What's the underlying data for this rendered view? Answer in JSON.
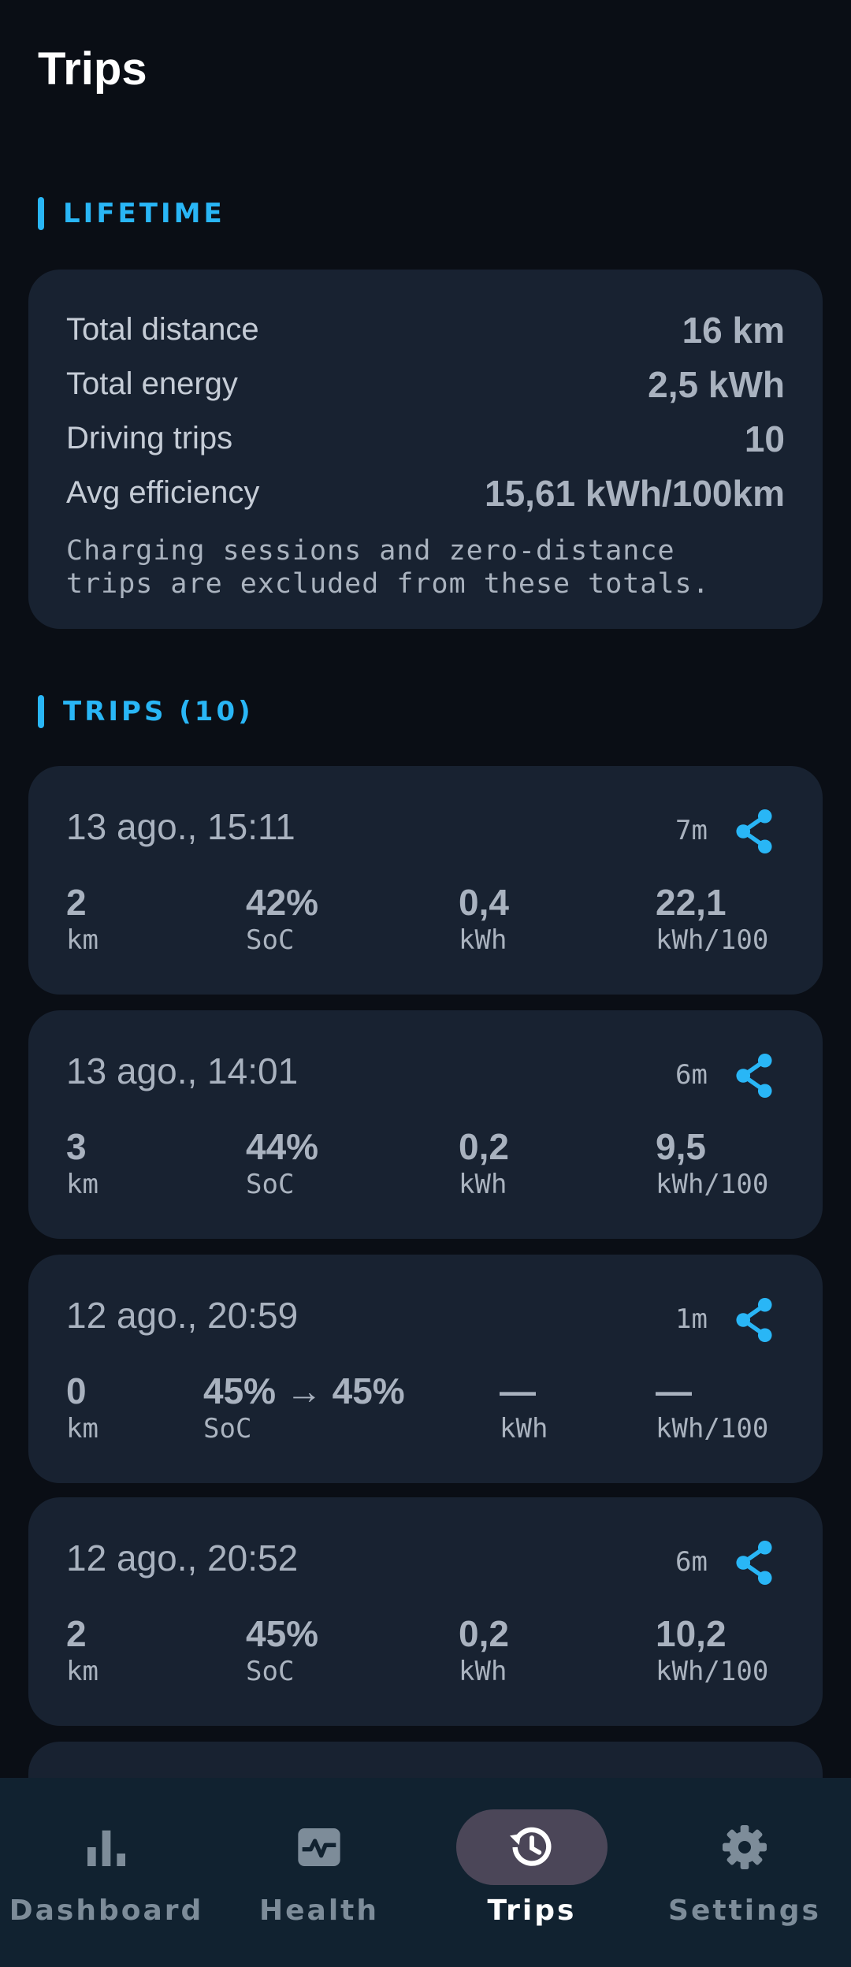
{
  "header": {
    "title": "Trips"
  },
  "lifetime": {
    "section_label": "LIFETIME",
    "stats": [
      {
        "label": "Total distance",
        "value": "16 km"
      },
      {
        "label": "Total energy",
        "value": "2,5 kWh"
      },
      {
        "label": "Driving trips",
        "value": "10"
      },
      {
        "label": "Avg efficiency",
        "value": "15,61 kWh/100km"
      }
    ],
    "note_line1": "Charging sessions and zero-distance",
    "note_line2": "trips are excluded from these totals."
  },
  "trips": {
    "section_label": "TRIPS (10)",
    "items": [
      {
        "date": "13 ago., 15:11",
        "duration": "7m",
        "distance": "2",
        "distance_unit": "km",
        "soc": "42%",
        "soc_unit": "SoC",
        "energy": "0,4",
        "energy_unit": "kWh",
        "efficiency": "22,1",
        "efficiency_unit": "kWh/100"
      },
      {
        "date": "13 ago., 14:01",
        "duration": "6m",
        "distance": "3",
        "distance_unit": "km",
        "soc": "44%",
        "soc_unit": "SoC",
        "energy": "0,2",
        "energy_unit": "kWh",
        "efficiency": "9,5",
        "efficiency_unit": "kWh/100"
      },
      {
        "date": "12 ago., 20:59",
        "duration": "1m",
        "distance": "0",
        "distance_unit": "km",
        "soc": "45% → 45%",
        "soc_unit": "SoC",
        "energy": "—",
        "energy_unit": "kWh",
        "efficiency": "—",
        "efficiency_unit": "kWh/100"
      },
      {
        "date": "12 ago., 20:52",
        "duration": "6m",
        "distance": "2",
        "distance_unit": "km",
        "soc": "45%",
        "soc_unit": "SoC",
        "energy": "0,2",
        "energy_unit": "kWh",
        "efficiency": "10,2",
        "efficiency_unit": "kWh/100"
      }
    ]
  },
  "nav": {
    "items": [
      {
        "label": "Dashboard",
        "icon": "bar-chart-icon",
        "active": false
      },
      {
        "label": "Health",
        "icon": "heart-monitor-icon",
        "active": false
      },
      {
        "label": "Trips",
        "icon": "history-icon",
        "active": true
      },
      {
        "label": "Settings",
        "icon": "gear-icon",
        "active": false
      }
    ]
  },
  "colors": {
    "accent": "#29b6f6",
    "card": "#182231",
    "background": "#0a0e15",
    "nav_pill": "#4b4658"
  }
}
